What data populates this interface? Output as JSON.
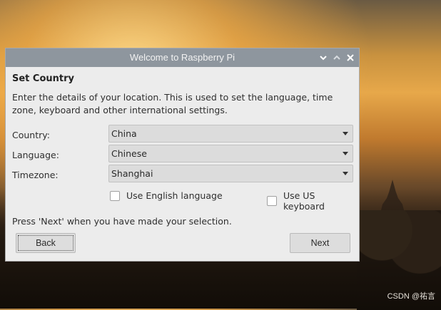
{
  "dialog": {
    "title": "Welcome to Raspberry Pi",
    "heading": "Set Country",
    "description": "Enter the details of your location. This is used to set the language, time zone, keyboard and other international settings.",
    "fields": {
      "country_label": "Country:",
      "country_value": "China",
      "language_label": "Language:",
      "language_value": "Chinese",
      "timezone_label": "Timezone:",
      "timezone_value": "Shanghai"
    },
    "checkboxes": {
      "english_label": "Use English language",
      "english_checked": false,
      "us_keyboard_label": "Use US keyboard",
      "us_keyboard_checked": false
    },
    "hint": "Press 'Next' when you have made your selection.",
    "buttons": {
      "back": "Back",
      "next": "Next"
    }
  },
  "titlebar_icons": [
    "chevron-down-icon",
    "chevron-up-icon",
    "close-icon"
  ],
  "watermark": "CSDN @祐言",
  "colors": {
    "titlebar": "#8e969e",
    "dialog_bg": "#ececec",
    "field_bg": "#dcdcdc"
  }
}
